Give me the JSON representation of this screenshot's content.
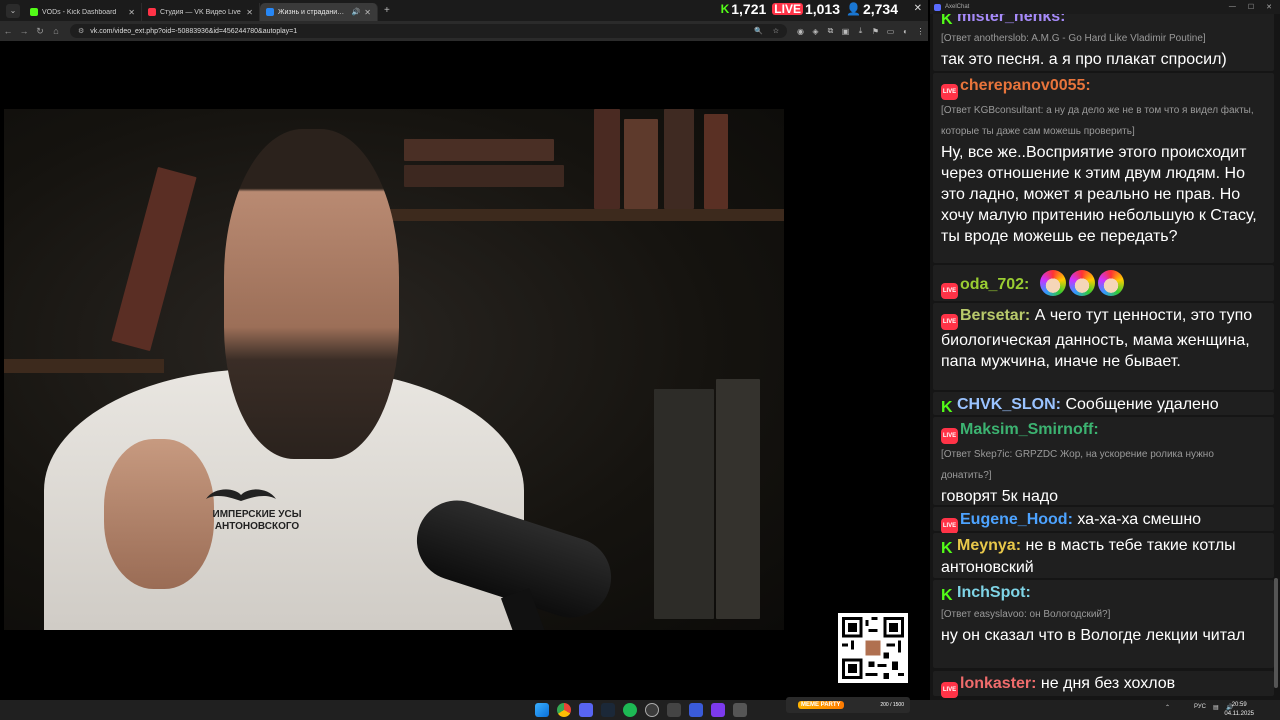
{
  "browser": {
    "tabs": [
      {
        "label": "VODs - Kick Dashboard",
        "fav_color": "#53fc18",
        "active": false
      },
      {
        "label": "Студия — VK Видео Live",
        "fav_color": "#ff3347",
        "active": false
      },
      {
        "label": "Жизнь и страдания Роман...",
        "fav_color": "#2787f5",
        "active": true
      }
    ],
    "new_tab": "+",
    "address": "vk.com/video_ext.php?oid=-50883936&id=456244780&autoplay=1"
  },
  "stats": {
    "kick_viewers": "1,721",
    "vk_viewers": "1,013",
    "total_viewers": "2,734"
  },
  "video": {
    "shirt_logo": "ИМПЕРСКИЕ УСЫ АНТОНОВСКОГО"
  },
  "chat": {
    "window_title": "AxelChat",
    "messages": [
      {
        "platform": "kick",
        "user": "mister_henks:",
        "user_color": "#a68af9",
        "reply": "[Ответ anotherslob: A.M.G - Go Hard Like Vladimir Poutine]",
        "text": "так это песня. а я про плакат спросил)"
      },
      {
        "platform": "vk",
        "user": "cherepanov0055:",
        "user_color": "#e8743b",
        "reply": "[Ответ KGBconsultant: а ну да дело же не в том что я видел факты, которые ты даже сам можешь проверить]",
        "text": "Ну, все же..Восприятие этого происходит через отношение к этим двум людям. Но это ладно, может я реально не прав. Но хочу малую притению небольшую к Стасу, ты вроде можешь ее передать?"
      },
      {
        "platform": "vk",
        "user": "oda_702:",
        "user_color": "#9acd32",
        "reply": "",
        "text": ""
      },
      {
        "platform": "vk",
        "user": "Bersetar:",
        "user_color": "#b8c96b",
        "reply": "",
        "text": "А чего тут ценности, это тупо биологическая данность, мама женщина, папа мужчина, иначе не бывает."
      },
      {
        "platform": "kick",
        "user": "CHVK_SLON:",
        "user_color": "#9ac3ff",
        "reply": "",
        "text": "Сообщение удалено"
      },
      {
        "platform": "vk",
        "user": "Maksim_Smirnoff:",
        "user_color": "#3cb371",
        "reply": "[Ответ Skep7ic: GRPZDC Жор, на ускорение ролика нужно донатить?]",
        "text": "говорят 5к надо"
      },
      {
        "platform": "vk",
        "user": "Eugene_Hood:",
        "user_color": "#4da3ff",
        "reply": "",
        "text": "ха-ха-ха смешно"
      },
      {
        "platform": "kick",
        "user": "Meynya:",
        "user_color": "#e8c84a",
        "reply": "",
        "text": "не в масть тебе такие котлы антоновский"
      },
      {
        "platform": "kick",
        "user": "InchSpot:",
        "user_color": "#7fd4e6",
        "reply": "[Ответ easyslavoo: он Вологодский?]",
        "text": "ну он сказал что в Вологде лекции читал"
      },
      {
        "platform": "vk",
        "user": "lonkaster:",
        "user_color": "#f06c6c",
        "reply": "",
        "text": "не дня без хохлов"
      }
    ]
  },
  "taskbar": {
    "widget_label": "MEME PARTY",
    "widget_count": "200 / 1500",
    "lang": "РУС",
    "time": "20:59",
    "date": "04.11.2025"
  }
}
